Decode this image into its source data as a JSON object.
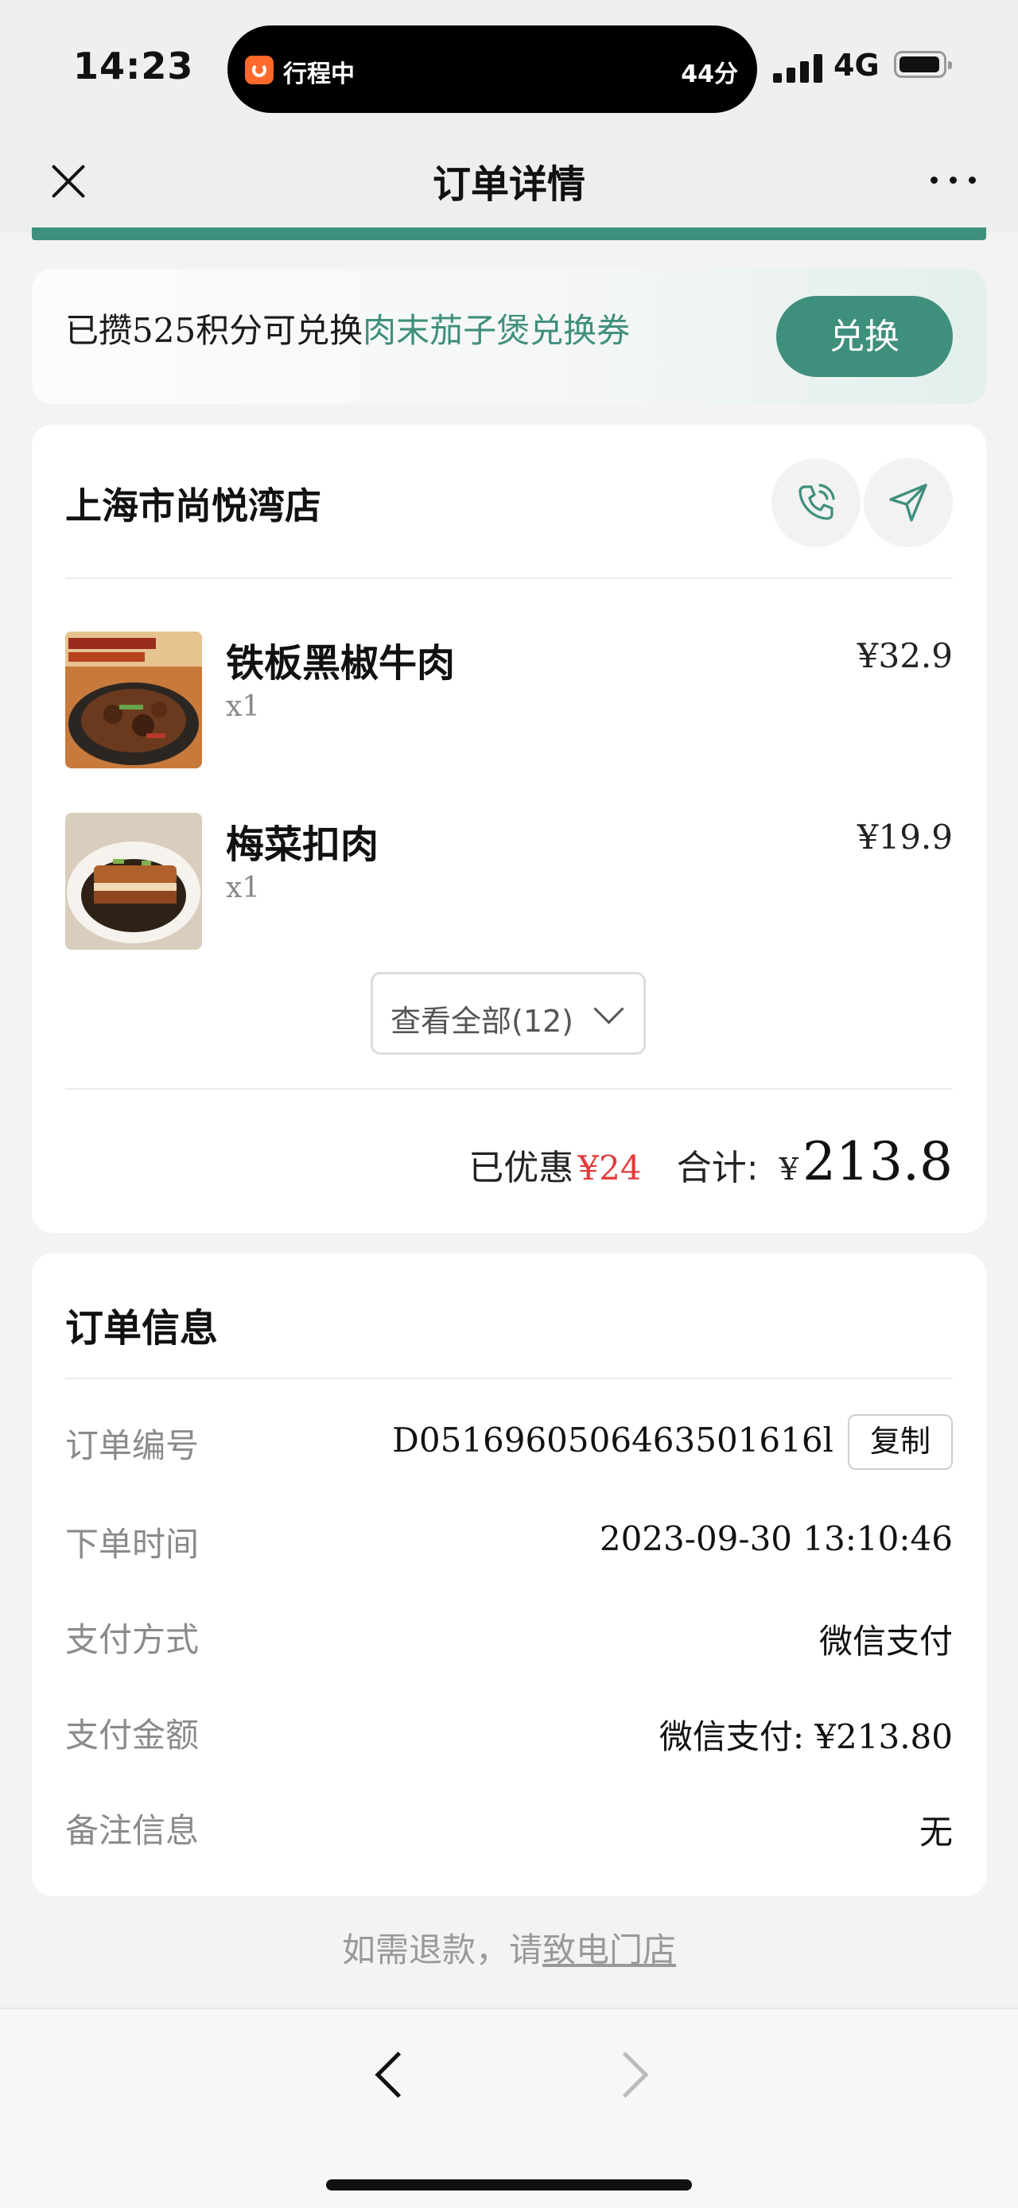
{
  "status_bar": {
    "time": "14:23",
    "island_label": "行程中",
    "island_minutes": "44分",
    "network": "4G",
    "app_icon": "didi-app-icon",
    "signal_icon": "cellular-signal-icon",
    "battery_icon": "battery-icon"
  },
  "nav": {
    "title": "订单详情",
    "close_icon": "close-icon",
    "more_icon": "more-dots-icon"
  },
  "points_banner": {
    "text_prefix": "已攒525积分可兑换",
    "text_highlight": "肉末茄子煲兑换券",
    "button_label": "兑换",
    "highlight_color": "#3f8f7d"
  },
  "store": {
    "name": "上海市尚悦湾店",
    "phone_icon": "phone-icon",
    "navigate_icon": "navigation-arrow-icon",
    "items": [
      {
        "name": "铁板黑椒牛肉",
        "qty": "x1",
        "price": "¥32.9"
      },
      {
        "name": "梅菜扣肉",
        "qty": "x1",
        "price": "¥19.9"
      }
    ],
    "view_all_label": "查看全部(12)",
    "discount_label": "已优惠",
    "discount_value": "¥24",
    "total_label": "合计:",
    "total_currency": "¥",
    "total_value": "213.8"
  },
  "order_info": {
    "title": "订单信息",
    "rows": [
      {
        "key": "订单编号",
        "value": "D0516960506463501616l"
      },
      {
        "key": "下单时间",
        "value": "2023-09-30 13:10:46"
      },
      {
        "key": "支付方式",
        "value": "微信支付"
      },
      {
        "key": "支付金额",
        "value": "微信支付: ¥213.80"
      },
      {
        "key": "备注信息",
        "value": "无"
      }
    ],
    "copy_label": "复制"
  },
  "refund": {
    "prefix": "如需退款，请",
    "link": "致电门店"
  },
  "bottom_nav": {
    "back_icon": "chevron-left-icon",
    "forward_icon": "chevron-right-icon"
  },
  "colors": {
    "accent": "#3f8f7d",
    "discount_red": "#e23b3b"
  }
}
